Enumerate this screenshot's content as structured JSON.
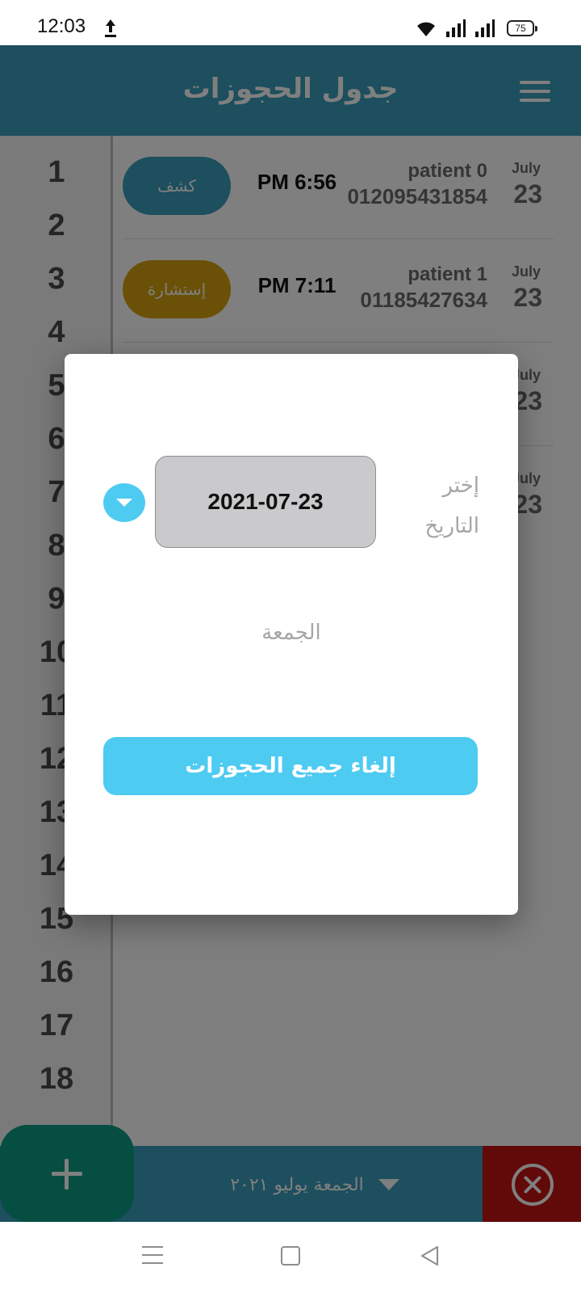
{
  "status_bar": {
    "time": "12:03",
    "battery": "75"
  },
  "app_bar": {
    "title": "جدول الحجوزات"
  },
  "hours": [
    "1",
    "2",
    "3",
    "4",
    "5",
    "6",
    "7",
    "8",
    "9",
    "10",
    "11",
    "12",
    "13",
    "14",
    "15",
    "16",
    "17",
    "18"
  ],
  "appointments": [
    {
      "type": "كشف",
      "type_color": "#3b9fbd",
      "time": "PM 6:56",
      "name": "patient 0",
      "phone": "012095431854",
      "month": "July",
      "day": "23"
    },
    {
      "type": "إستشارة",
      "type_color": "#d4a30f",
      "time": "PM 7:11",
      "name": "patient 1",
      "phone": "01185427634",
      "month": "July",
      "day": "23"
    },
    {
      "month": "July",
      "day": "23"
    },
    {
      "month": "July",
      "day": "23"
    }
  ],
  "bottom_bar": {
    "date_text": "الجمعة يوليو ٢٠٢١"
  },
  "dialog": {
    "date_label": "إختر التاريخ",
    "date_value": "2021-07-23",
    "day_name": "الجمعة",
    "cancel_all_label": "إلغاء جميع الحجوزات"
  },
  "colors": {
    "primary": "#3b9fbd",
    "accent": "#4ecbf1",
    "fab": "#0d9c84",
    "close": "#c41212"
  },
  "icons": [
    "upload-icon",
    "wifi-icon",
    "signal-icon",
    "battery-icon",
    "menu-icon",
    "plus-icon",
    "close-circle-icon",
    "chevron-down-icon",
    "recents-icon",
    "home-icon",
    "back-icon"
  ]
}
